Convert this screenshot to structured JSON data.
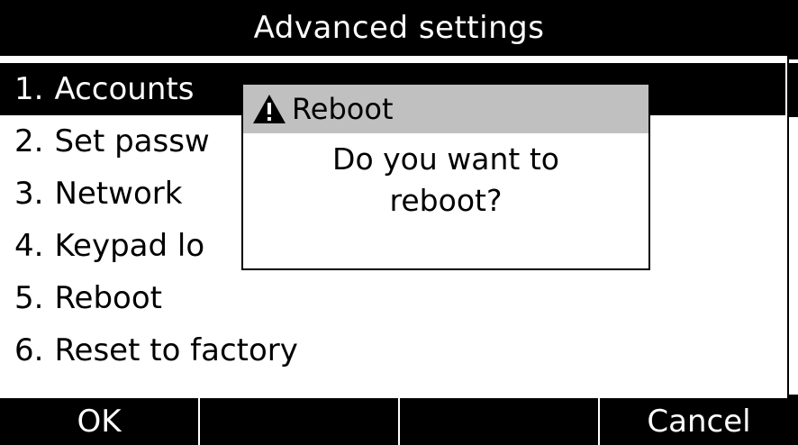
{
  "header": {
    "title": "Advanced settings"
  },
  "menu": {
    "items": [
      {
        "number": "1.",
        "label": "Accounts",
        "selected": true
      },
      {
        "number": "2.",
        "label": "Set passw"
      },
      {
        "number": "3.",
        "label": "Network"
      },
      {
        "number": "4.",
        "label": "Keypad lo"
      },
      {
        "number": "5.",
        "label": "Reboot"
      },
      {
        "number": "6.",
        "label": "Reset to factory"
      }
    ]
  },
  "dialog": {
    "title": "Reboot",
    "icon": "warning-icon",
    "message_line1": "Do you want to",
    "message_line2": "reboot?"
  },
  "softkeys": {
    "key1": "OK",
    "key2": "",
    "key3": "",
    "key4": "Cancel"
  },
  "colors": {
    "background": "#ffffff",
    "bars": "#000000",
    "dialog_header": "#c0c0c0"
  }
}
